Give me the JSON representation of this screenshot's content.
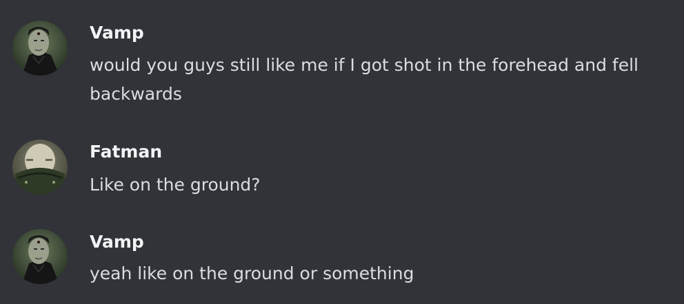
{
  "messages": [
    {
      "author": "Vamp",
      "avatar_icon": "vamp-avatar",
      "text": "would you guys still like me if I got shot in the forehead and fell backwards"
    },
    {
      "author": "Fatman",
      "avatar_icon": "fatman-avatar",
      "text": "Like on the ground?"
    },
    {
      "author": "Vamp",
      "avatar_icon": "vamp-avatar",
      "text": "yeah like on the ground or something"
    }
  ],
  "colors": {
    "background": "#313338",
    "username": "#f2f3f5",
    "message_text": "#dbdee1"
  }
}
